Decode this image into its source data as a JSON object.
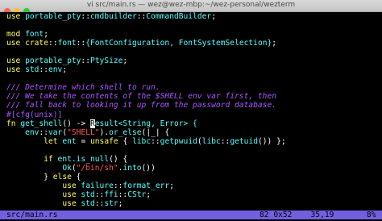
{
  "window": {
    "title": "vi src/main.rs — wez@wez-mbp:~/wez-personal/wezterm"
  },
  "editor": {
    "lines": [
      [
        {
          "t": "use ",
          "c": "kw"
        },
        {
          "t": "portable_pty",
          "c": "id"
        },
        {
          "t": "::",
          "c": "op"
        },
        {
          "t": "cmdbuilder",
          "c": "id"
        },
        {
          "t": "::",
          "c": "op"
        },
        {
          "t": "CommandBuilder",
          "c": "ty"
        },
        {
          "t": ";",
          "c": "op"
        }
      ],
      [],
      [
        {
          "t": "mod ",
          "c": "kw"
        },
        {
          "t": "font",
          "c": "id"
        },
        {
          "t": ";",
          "c": "op"
        }
      ],
      [
        {
          "t": "use ",
          "c": "kw"
        },
        {
          "t": "crate",
          "c": "kw"
        },
        {
          "t": "::",
          "c": "op"
        },
        {
          "t": "font",
          "c": "id"
        },
        {
          "t": "::",
          "c": "op"
        },
        {
          "t": "{FontConfiguration, FontSystemSelection}",
          "c": "ty"
        },
        {
          "t": ";",
          "c": "op"
        }
      ],
      [],
      [
        {
          "t": "use ",
          "c": "kw"
        },
        {
          "t": "portable_pty",
          "c": "id"
        },
        {
          "t": "::",
          "c": "op"
        },
        {
          "t": "PtySize",
          "c": "ty"
        },
        {
          "t": ";",
          "c": "op"
        }
      ],
      [
        {
          "t": "use ",
          "c": "kw"
        },
        {
          "t": "std",
          "c": "id"
        },
        {
          "t": "::",
          "c": "op"
        },
        {
          "t": "env",
          "c": "id"
        },
        {
          "t": ";",
          "c": "op"
        }
      ],
      [],
      [
        {
          "t": "/// Determine which shell to run.",
          "c": "com"
        }
      ],
      [
        {
          "t": "/// We take the contents of the $SHELL env var first, then",
          "c": "com"
        }
      ],
      [
        {
          "t": "/// fall back to looking it up from the password database.",
          "c": "com"
        }
      ],
      [
        {
          "t": "#[cfg(unix)]",
          "c": "attr"
        }
      ],
      [
        {
          "t": "fn ",
          "c": "kw"
        },
        {
          "t": "get_shell",
          "c": "fn"
        },
        {
          "t": "() -> ",
          "c": "op"
        },
        {
          "t": "R",
          "c": "cursor"
        },
        {
          "t": "esult",
          "c": "ty"
        },
        {
          "t": "<String, Error> {",
          "c": "ty"
        }
      ],
      [
        {
          "t": "    ",
          "c": "op"
        },
        {
          "t": "env",
          "c": "id"
        },
        {
          "t": "::",
          "c": "op"
        },
        {
          "t": "var",
          "c": "fn"
        },
        {
          "t": "(",
          "c": "op"
        },
        {
          "t": "\"SHELL\"",
          "c": "str"
        },
        {
          "t": ").",
          "c": "op"
        },
        {
          "t": "or_else",
          "c": "fn"
        },
        {
          "t": "(|_| {",
          "c": "op"
        }
      ],
      [
        {
          "t": "        ",
          "c": "op"
        },
        {
          "t": "let ",
          "c": "kw"
        },
        {
          "t": "ent ",
          "c": "id"
        },
        {
          "t": "= ",
          "c": "op"
        },
        {
          "t": "unsafe ",
          "c": "kw"
        },
        {
          "t": "{ ",
          "c": "op"
        },
        {
          "t": "libc",
          "c": "id"
        },
        {
          "t": "::",
          "c": "op"
        },
        {
          "t": "getpwuid",
          "c": "fn"
        },
        {
          "t": "(",
          "c": "op"
        },
        {
          "t": "libc",
          "c": "id"
        },
        {
          "t": "::",
          "c": "op"
        },
        {
          "t": "getuid",
          "c": "fn"
        },
        {
          "t": "()) };",
          "c": "op"
        }
      ],
      [],
      [
        {
          "t": "        ",
          "c": "op"
        },
        {
          "t": "if ",
          "c": "kw"
        },
        {
          "t": "ent.",
          "c": "id"
        },
        {
          "t": "is_null",
          "c": "fn"
        },
        {
          "t": "() {",
          "c": "op"
        }
      ],
      [
        {
          "t": "            ",
          "c": "op"
        },
        {
          "t": "Ok",
          "c": "ty"
        },
        {
          "t": "(",
          "c": "op"
        },
        {
          "t": "\"/bin/sh\"",
          "c": "str"
        },
        {
          "t": ".",
          "c": "op"
        },
        {
          "t": "into",
          "c": "fn"
        },
        {
          "t": "())",
          "c": "op"
        }
      ],
      [
        {
          "t": "        ",
          "c": "op"
        },
        {
          "t": "} ",
          "c": "op"
        },
        {
          "t": "else ",
          "c": "kw"
        },
        {
          "t": "{",
          "c": "op"
        }
      ],
      [
        {
          "t": "            ",
          "c": "op"
        },
        {
          "t": "use ",
          "c": "kw"
        },
        {
          "t": "failure",
          "c": "id"
        },
        {
          "t": "::",
          "c": "op"
        },
        {
          "t": "format_err",
          "c": "fn"
        },
        {
          "t": ";",
          "c": "op"
        }
      ],
      [
        {
          "t": "            ",
          "c": "op"
        },
        {
          "t": "use ",
          "c": "kw"
        },
        {
          "t": "std",
          "c": "id"
        },
        {
          "t": "::",
          "c": "op"
        },
        {
          "t": "ffi",
          "c": "id"
        },
        {
          "t": "::",
          "c": "op"
        },
        {
          "t": "CStr",
          "c": "ty"
        },
        {
          "t": ";",
          "c": "op"
        }
      ],
      [
        {
          "t": "            ",
          "c": "op"
        },
        {
          "t": "use ",
          "c": "kw"
        },
        {
          "t": "std",
          "c": "id"
        },
        {
          "t": "::",
          "c": "op"
        },
        {
          "t": "str",
          "c": "id"
        },
        {
          "t": ";",
          "c": "op"
        }
      ]
    ]
  },
  "statusbar": {
    "file": "src/main.rs",
    "right": "82 0x52    35,19       8%"
  },
  "colors": {
    "background": "#000000",
    "statusbar": "#7060e0",
    "keyword": "#ffff55",
    "type": "#55ffff",
    "string": "#ff5555",
    "comment": "#aa55ff"
  }
}
